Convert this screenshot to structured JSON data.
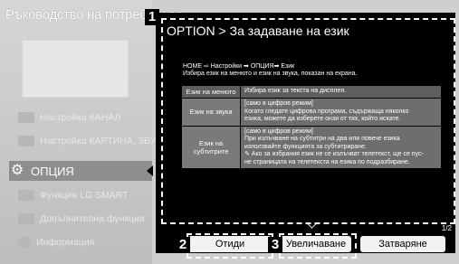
{
  "sidebar": {
    "title": "Ръководство на потребителя",
    "items": [
      {
        "label": "Настройка КАНАЛ",
        "icon": "satellite-dish-icon"
      },
      {
        "label": "Настройка КАРТИНА, ЗВУК",
        "icon": "picture-sound-icon"
      },
      {
        "label": "ОПЦИЯ",
        "icon": "gear-icon"
      },
      {
        "label": "Функция LG SMART",
        "icon": "smart-tv-icon"
      },
      {
        "label": "Допълнителна функция",
        "icon": "extra-function-icon"
      },
      {
        "label": "Информация",
        "icon": "info-icon"
      }
    ]
  },
  "callouts": {
    "one": "1",
    "two": "2",
    "three": "3"
  },
  "panel": {
    "title": "OPTION > За задаване на език",
    "breadcrumb": "HOME ⇨ Настройки ➡ ОПЦИЯ➡ Език",
    "description": "Избира език на менюто и език на звука, показан на екрана.",
    "rows": [
      {
        "key": "Език на менюто",
        "value": "Избира език за текста на дисплея."
      },
      {
        "key": "Език на звука",
        "value": "[само в цифров режим]\nКогато гледате цифрова програма, съдържаща няколко\nезика, можете да изберете онзи от тях, който искате."
      },
      {
        "key": "Език на\nсубтитрите",
        "value": "[само в цифров режим]\nПри излъчване на субтитри на два или повече езика\nизползвайте функцията за субтитриране.\n✎ Ако за избрания език не се излъчват телетекст, ще се пус-\n    не страницата на телетекста на езика по подразбиране."
      }
    ],
    "page_indicator": "1/2"
  },
  "buttons": {
    "goto": "Отиди",
    "zoom": "Увеличаване",
    "close": "Затваряне"
  },
  "colors": {
    "panel_bg": "#000000",
    "sidebar_bg": "#cfcfcf",
    "highlight": "#8e8e8e",
    "table_cell": "#6e6e6e"
  }
}
